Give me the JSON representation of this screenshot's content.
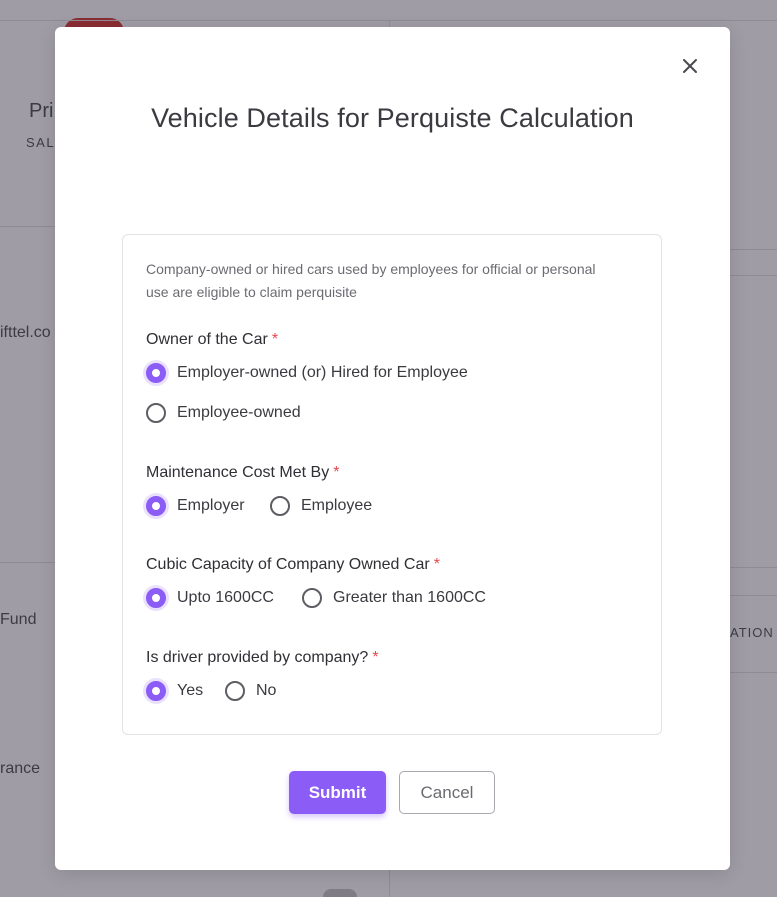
{
  "background": {
    "partial_texts": [
      "Pri",
      "SAL",
      "ifttel.co",
      "Fund",
      "rance",
      "ATION"
    ]
  },
  "modal": {
    "title": "Vehicle Details for Perquiste Calculation",
    "close_icon": "close-icon",
    "description": "Company-owned or hired cars used by employees for official or personal use are eligible to claim perquisite",
    "accent_color": "#8b5cf6",
    "required_color": "#e5484d",
    "questions": [
      {
        "label": "Owner of the Car",
        "required_mark": "*",
        "options": [
          {
            "label": "Employer-owned (or) Hired for Employee",
            "selected": true
          },
          {
            "label": "Employee-owned",
            "selected": false
          }
        ]
      },
      {
        "label": "Maintenance Cost Met By",
        "required_mark": "*",
        "options": [
          {
            "label": "Employer",
            "selected": true
          },
          {
            "label": "Employee",
            "selected": false
          }
        ]
      },
      {
        "label": "Cubic Capacity of Company Owned Car",
        "required_mark": "*",
        "options": [
          {
            "label": "Upto 1600CC",
            "selected": true
          },
          {
            "label": "Greater than 1600CC",
            "selected": false
          }
        ]
      },
      {
        "label": "Is driver provided by company?",
        "required_mark": "*",
        "options": [
          {
            "label": "Yes",
            "selected": true
          },
          {
            "label": "No",
            "selected": false
          }
        ]
      }
    ],
    "submit_label": "Submit",
    "cancel_label": "Cancel"
  }
}
